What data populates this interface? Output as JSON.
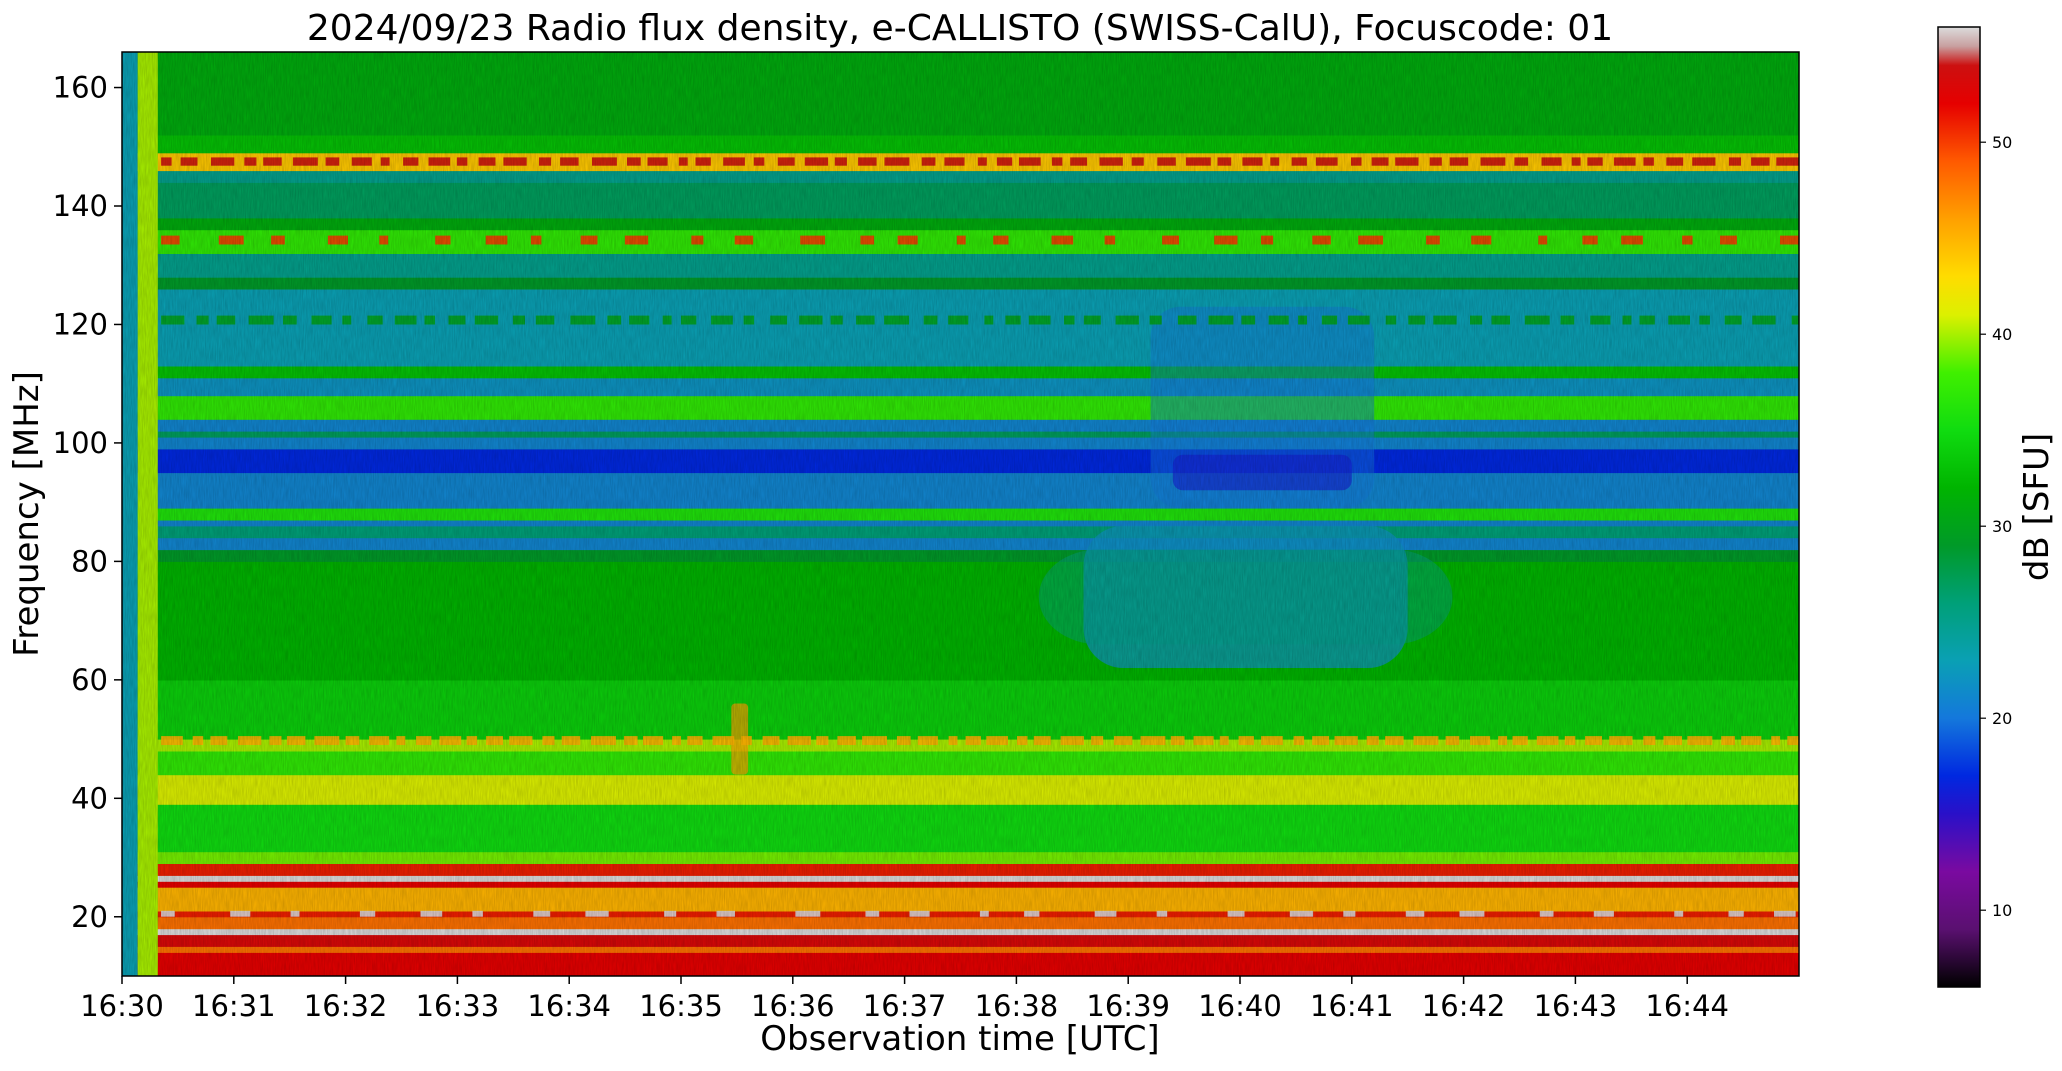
{
  "chart_data": {
    "type": "heatmap",
    "title": "2024/09/23  Radio flux density, e-CALLISTO (SWISS-CalU), Focuscode: 01",
    "xlabel": "Observation time [UTC]",
    "ylabel": "Frequency [MHz]",
    "colorbar_label": "dB [SFU]",
    "x_tick_labels": [
      "16:30",
      "16:31",
      "16:32",
      "16:33",
      "16:34",
      "16:35",
      "16:36",
      "16:37",
      "16:38",
      "16:39",
      "16:40",
      "16:41",
      "16:42",
      "16:43",
      "16:44"
    ],
    "x_range_minutes": [
      0,
      15
    ],
    "y_ticks": [
      20,
      40,
      60,
      80,
      100,
      120,
      140,
      160
    ],
    "ylim": [
      10,
      166
    ],
    "colorbar_ticks": [
      10,
      20,
      30,
      40,
      50
    ],
    "colorbar_range": [
      6,
      56
    ],
    "colormap_stops": [
      {
        "v": 6,
        "c": "#000000"
      },
      {
        "v": 9,
        "c": "#5a1070"
      },
      {
        "v": 12,
        "c": "#7a0aa0"
      },
      {
        "v": 15,
        "c": "#2a10c8"
      },
      {
        "v": 17,
        "c": "#0028e0"
      },
      {
        "v": 20,
        "c": "#1478dc"
      },
      {
        "v": 23,
        "c": "#0aa0b4"
      },
      {
        "v": 26,
        "c": "#00a078"
      },
      {
        "v": 29,
        "c": "#009a28"
      },
      {
        "v": 32,
        "c": "#00b400"
      },
      {
        "v": 35,
        "c": "#10dc10"
      },
      {
        "v": 38,
        "c": "#40f000"
      },
      {
        "v": 41,
        "c": "#dcf000"
      },
      {
        "v": 43,
        "c": "#ffdc00"
      },
      {
        "v": 46,
        "c": "#ffa000"
      },
      {
        "v": 49,
        "c": "#ff5a00"
      },
      {
        "v": 52,
        "c": "#e60000"
      },
      {
        "v": 54,
        "c": "#cc1010"
      },
      {
        "v": 55,
        "c": "#c8a0a0"
      },
      {
        "v": 56,
        "c": "#dcdcdc"
      }
    ],
    "frequency_bands_db": [
      {
        "f0": 10,
        "f1": 14,
        "db": 52
      },
      {
        "f0": 14,
        "f1": 15,
        "db": 48
      },
      {
        "f0": 15,
        "f1": 17,
        "db": 53
      },
      {
        "f0": 17,
        "f1": 18,
        "db": 56
      },
      {
        "f0": 18,
        "f1": 20,
        "db": 48
      },
      {
        "f0": 20,
        "f1": 21,
        "db": 51
      },
      {
        "f0": 21,
        "f1": 25,
        "db": 45
      },
      {
        "f0": 25,
        "f1": 26,
        "db": 52
      },
      {
        "f0": 26,
        "f1": 27,
        "db": 56
      },
      {
        "f0": 27,
        "f1": 29,
        "db": 51
      },
      {
        "f0": 29,
        "f1": 31,
        "db": 39
      },
      {
        "f0": 31,
        "f1": 39,
        "db": 35
      },
      {
        "f0": 39,
        "f1": 44,
        "db": 41
      },
      {
        "f0": 44,
        "f1": 48,
        "db": 37
      },
      {
        "f0": 48,
        "f1": 50,
        "db": 40
      },
      {
        "f0": 50,
        "f1": 60,
        "db": 34
      },
      {
        "f0": 60,
        "f1": 80,
        "db": 32
      },
      {
        "f0": 80,
        "f1": 82,
        "db": 29
      },
      {
        "f0": 82,
        "f1": 84,
        "db": 21
      },
      {
        "f0": 84,
        "f1": 86,
        "db": 26
      },
      {
        "f0": 86,
        "f1": 87,
        "db": 21
      },
      {
        "f0": 87,
        "f1": 89,
        "db": 36
      },
      {
        "f0": 89,
        "f1": 95,
        "db": 21
      },
      {
        "f0": 95,
        "f1": 99,
        "db": 17
      },
      {
        "f0": 99,
        "f1": 101,
        "db": 21
      },
      {
        "f0": 101,
        "f1": 102,
        "db": 27
      },
      {
        "f0": 102,
        "f1": 104,
        "db": 21
      },
      {
        "f0": 104,
        "f1": 108,
        "db": 37
      },
      {
        "f0": 108,
        "f1": 111,
        "db": 22
      },
      {
        "f0": 111,
        "f1": 113,
        "db": 33
      },
      {
        "f0": 113,
        "f1": 126,
        "db": 23
      },
      {
        "f0": 126,
        "f1": 128,
        "db": 29
      },
      {
        "f0": 128,
        "f1": 132,
        "db": 25
      },
      {
        "f0": 132,
        "f1": 136,
        "db": 37
      },
      {
        "f0": 136,
        "f1": 138,
        "db": 31
      },
      {
        "f0": 138,
        "f1": 144,
        "db": 27
      },
      {
        "f0": 144,
        "f1": 146,
        "db": 25
      },
      {
        "f0": 146,
        "f1": 149,
        "db": 44
      },
      {
        "f0": 149,
        "f1": 152,
        "db": 33
      },
      {
        "f0": 152,
        "f1": 166,
        "db": 31
      }
    ]
  }
}
